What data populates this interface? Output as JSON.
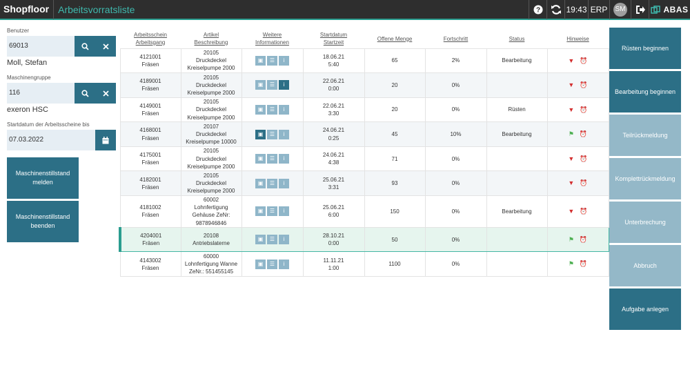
{
  "header": {
    "brand": "Shopfloor",
    "title": "Arbeitsvorratsliste",
    "time": "19:43",
    "erp": "ERP",
    "user_initials": "SM",
    "logo": "ABAS"
  },
  "left": {
    "user_label": "Benutzer",
    "user_value": "69013",
    "user_name": "Moll, Stefan",
    "group_label": "Maschinengruppe",
    "group_value": "116",
    "group_name": "exeron HSC",
    "date_label": "Startdatum der Arbeitsscheine bis",
    "date_value": "07.03.2022",
    "btn_report": "Maschinenstillstand melden",
    "btn_end": "Maschinenstillstand beenden"
  },
  "table": {
    "headers": {
      "col1a": "Arbeitsschein",
      "col1b": "Arbeitsgang",
      "col2a": "Artikel",
      "col2b": "Beschreibung",
      "col3a": "Weitere",
      "col3b": "Informationen",
      "col4a": "Startdatum",
      "col4b": "Startzeit",
      "col5": "Offene Menge",
      "col6": "Fortschritt",
      "col7": "Status",
      "col8": "Hinweise"
    },
    "rows": [
      {
        "schein": "4121001",
        "gang": "Fräsen",
        "artikel": "20105",
        "desc1": "Druckdeckel",
        "desc2": "Kreiselpumpe 2000",
        "date": "18.06.21",
        "time": "5:40",
        "menge": "65",
        "progress": "2%",
        "status": "Bearbeitung"
      },
      {
        "schein": "4189001",
        "gang": "Fräsen",
        "artikel": "20105",
        "desc1": "Druckdeckel",
        "desc2": "Kreiselpumpe 2000",
        "date": "22.06.21",
        "time": "0:00",
        "menge": "20",
        "progress": "0%",
        "status": ""
      },
      {
        "schein": "4149001",
        "gang": "Fräsen",
        "artikel": "20105",
        "desc1": "Druckdeckel",
        "desc2": "Kreiselpumpe 2000",
        "date": "22.06.21",
        "time": "3:30",
        "menge": "20",
        "progress": "0%",
        "status": "Rüsten"
      },
      {
        "schein": "4168001",
        "gang": "Fräsen",
        "artikel": "20107",
        "desc1": "Druckdeckel",
        "desc2": "Kreiselpumpe 10000",
        "date": "24.06.21",
        "time": "0:25",
        "menge": "45",
        "progress": "10%",
        "status": "Bearbeitung"
      },
      {
        "schein": "4175001",
        "gang": "Fräsen",
        "artikel": "20105",
        "desc1": "Druckdeckel",
        "desc2": "Kreiselpumpe 2000",
        "date": "24.06.21",
        "time": "4:38",
        "menge": "71",
        "progress": "0%",
        "status": ""
      },
      {
        "schein": "4182001",
        "gang": "Fräsen",
        "artikel": "20105",
        "desc1": "Druckdeckel",
        "desc2": "Kreiselpumpe 2000",
        "date": "25.06.21",
        "time": "3:31",
        "menge": "93",
        "progress": "0%",
        "status": ""
      },
      {
        "schein": "4181002",
        "gang": "Fräsen",
        "artikel": "60002",
        "desc1": "Lohnfertigung",
        "desc2": "Gehäuse ZeNr:",
        "desc3": "9878946846",
        "date": "25.06.21",
        "time": "6:00",
        "menge": "150",
        "progress": "0%",
        "status": "Bearbeitung"
      },
      {
        "schein": "4204001",
        "gang": "Fräsen",
        "artikel": "20108",
        "desc1": "Antriebslaterne",
        "desc2": "",
        "date": "28.10.21",
        "time": "0:00",
        "menge": "50",
        "progress": "0%",
        "status": ""
      },
      {
        "schein": "4143002",
        "gang": "Fräsen",
        "artikel": "60000",
        "desc1": "Lohnfertigung Wanne",
        "desc2": "ZeNr.: 551455145",
        "date": "11.11.21",
        "time": "1:00",
        "menge": "1100",
        "progress": "0%",
        "status": ""
      }
    ]
  },
  "right": {
    "btn1": "Rüsten beginnen",
    "btn2": "Bearbeitung beginnen",
    "btn3": "Teilrückmeldung",
    "btn4": "Komplettrückmeldung",
    "btn5": "Unterbrechung",
    "btn6": "Abbruch",
    "btn7": "Aufgabe anlegen"
  },
  "icons": {
    "image": "image-icon",
    "list": "list-icon",
    "info": "info-icon",
    "warn": "warning-icon",
    "alarm": "alarm-icon",
    "flag": "flag-icon"
  }
}
